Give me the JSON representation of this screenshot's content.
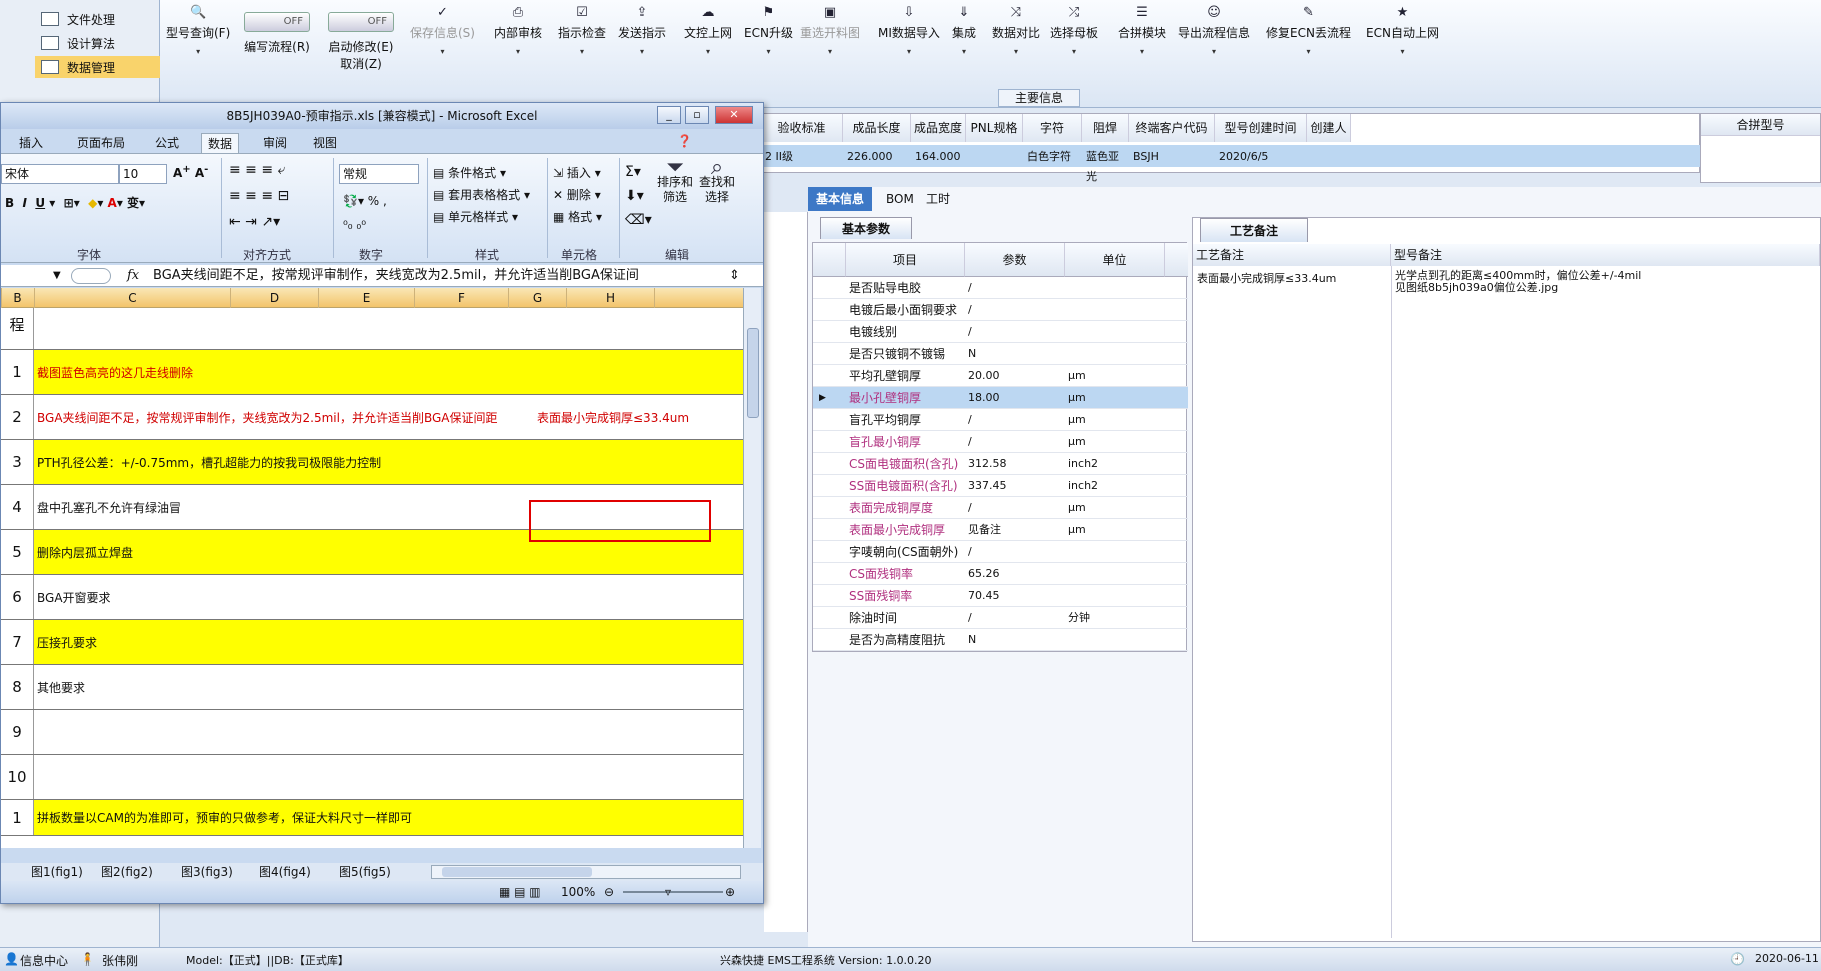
{
  "left_nav": [
    {
      "label": "文件处理"
    },
    {
      "label": "设计算法"
    },
    {
      "label": "数据管理"
    }
  ],
  "ribbon": [
    {
      "icon": "search-icon",
      "glyph": "🔍",
      "label": "型号查询(F)"
    },
    {
      "toggle": "OFF",
      "label": "编写流程(R)"
    },
    {
      "toggle": "OFF",
      "label": "启动修改(E)",
      "sub": "取消(Z)"
    },
    {
      "icon": "check-icon",
      "glyph": "✓",
      "label": "保存信息(S)",
      "disabled": true
    },
    {
      "icon": "print-icon",
      "glyph": "⎙",
      "label": "内部审核"
    },
    {
      "icon": "checkbox-icon",
      "glyph": "☑",
      "label": "指示检查"
    },
    {
      "icon": "upload-icon",
      "glyph": "⇪",
      "label": "发送指示"
    },
    {
      "icon": "cloud-upload-icon",
      "glyph": "☁",
      "label": "文控上网"
    },
    {
      "icon": "ecn-icon",
      "glyph": "⚑",
      "label": "ECN升级"
    },
    {
      "icon": "image-icon",
      "glyph": "▣",
      "label": "重选开料图",
      "disabled": true
    },
    {
      "icon": "download-icon",
      "glyph": "⇩",
      "label": "MI数据导入"
    },
    {
      "icon": "integrate-icon",
      "glyph": "⇓",
      "label": "集成"
    },
    {
      "icon": "compare-icon",
      "glyph": "⤨",
      "label": "数据对比"
    },
    {
      "icon": "shuffle-icon",
      "glyph": "⤮",
      "label": "选择母板"
    },
    {
      "icon": "list-icon",
      "glyph": "☰",
      "label": "合拼模块"
    },
    {
      "icon": "smile-icon",
      "glyph": "☺",
      "label": "导出流程信息"
    },
    {
      "icon": "wrench-icon",
      "glyph": "✎",
      "label": "修复ECN丢流程"
    },
    {
      "icon": "star-icon",
      "glyph": "★",
      "label": "ECN自动上网"
    }
  ],
  "main_info_label": "主要信息",
  "top_grid": {
    "headers": [
      "验收标准",
      "成品长度",
      "成品宽度",
      "PNL规格",
      "字符",
      "阻焊",
      "终端客户代码",
      "型号创建时间",
      "创建人"
    ],
    "row": [
      "2 II级",
      "226.000",
      "164.000",
      "",
      "白色字符",
      "蓝色亚光",
      "BSJH",
      "2020/6/5",
      ""
    ]
  },
  "merge_panel_header": "合拼型号",
  "tabs": [
    "基本信息",
    "BOM",
    "工时"
  ],
  "basic_params_tab": "基本参数",
  "basic_grid": {
    "headers": [
      "项目",
      "参数",
      "单位"
    ],
    "rows": [
      {
        "item": "是否贴导电胶",
        "value": "/",
        "unit": "",
        "pink": false
      },
      {
        "item": "电镀后最小面铜要求",
        "value": "/",
        "unit": "",
        "pink": false
      },
      {
        "item": "电镀线别",
        "value": "/",
        "unit": "",
        "pink": false
      },
      {
        "item": "是否只镀铜不镀锡",
        "value": "N",
        "unit": "",
        "pink": false
      },
      {
        "item": "平均孔壁铜厚",
        "value": "20.00",
        "unit": "μm",
        "pink": false
      },
      {
        "item": "最小孔壁铜厚",
        "value": "18.00",
        "unit": "μm",
        "pink": true,
        "selected": true
      },
      {
        "item": "盲孔平均铜厚",
        "value": "/",
        "unit": "μm",
        "pink": false
      },
      {
        "item": "盲孔最小铜厚",
        "value": "/",
        "unit": "μm",
        "pink": true
      },
      {
        "item": "CS面电镀面积(含孔)",
        "value": "312.58",
        "unit": "inch2",
        "pink": true
      },
      {
        "item": "SS面电镀面积(含孔)",
        "value": "337.45",
        "unit": "inch2",
        "pink": true
      },
      {
        "item": "表面完成铜厚度",
        "value": "/",
        "unit": "μm",
        "pink": true
      },
      {
        "item": "表面最小完成铜厚",
        "value": "见备注",
        "unit": "μm",
        "pink": true
      },
      {
        "item": "字唛朝向(CS面朝外)",
        "value": "/",
        "unit": "",
        "pink": false
      },
      {
        "item": "CS面残铜率",
        "value": "65.26",
        "unit": "",
        "pink": true
      },
      {
        "item": "SS面残铜率",
        "value": "70.45",
        "unit": "",
        "pink": true
      },
      {
        "item": "除油时间",
        "value": "/",
        "unit": "分钟",
        "pink": false
      },
      {
        "item": "是否为高精度阻抗",
        "value": "N",
        "unit": "",
        "pink": false
      }
    ]
  },
  "process_notes": {
    "tab": "工艺备注",
    "col1": "工艺备注",
    "col2": "型号备注",
    "note1": "表面最小完成铜厚≤33.4um",
    "note2_line1": "光学点到孔的距离≤400mm时，偏位公差+/-4mil",
    "note2_line2": "见图纸8b5jh039a0偏位公差.jpg"
  },
  "excel": {
    "title": "8B5JH039A0-预审指示.xls [兼容模式] - Microsoft Excel",
    "tabs": [
      "插入",
      "页面布局",
      "公式",
      "数据",
      "审阅",
      "视图"
    ],
    "active_tab": "数据",
    "font_name": "宋体",
    "font_size": "10",
    "number_format": "常规",
    "groups": [
      "字体",
      "对齐方式",
      "数字",
      "样式",
      "单元格",
      "编辑"
    ],
    "styles": [
      "条件格式",
      "套用表格格式",
      "单元格样式"
    ],
    "cells_cmds": [
      "插入",
      "删除",
      "格式"
    ],
    "edit_cmds": [
      "排序和筛选",
      "查找和选择"
    ],
    "formula_text": "BGA夹线间距不足，按常规评审制作，夹线宽改为2.5mil，并允许适当削BGA保证间",
    "columns": [
      "B",
      "C",
      "D",
      "E",
      "F",
      "G",
      "H"
    ],
    "header_cell": "程",
    "rows": [
      {
        "num": "1",
        "text": "截图蓝色高亮的这几走线删除",
        "yellow": true,
        "red": true
      },
      {
        "num": "2",
        "text": "BGA夹线间距不足，按常规评审制作，夹线宽改为2.5mil，并允许适当削BGA保证间距",
        "yellow": false,
        "red": true,
        "extra": "表面最小完成铜厚≤33.4um"
      },
      {
        "num": "3",
        "text": "PTH孔径公差：+/-0.75mm，槽孔超能力的按我司极限能力控制",
        "yellow": true,
        "red": false
      },
      {
        "num": "4",
        "text": "盘中孔塞孔不允许有绿油冒",
        "yellow": false,
        "red": false
      },
      {
        "num": "5",
        "text": "删除内层孤立焊盘",
        "yellow": true,
        "red": false
      },
      {
        "num": "6",
        "text": "BGA开窗要求",
        "yellow": false,
        "red": false
      },
      {
        "num": "7",
        "text": "压接孔要求",
        "yellow": true,
        "red": false
      },
      {
        "num": "8",
        "text": "其他要求",
        "yellow": false,
        "red": false
      },
      {
        "num": "9",
        "text": "",
        "yellow": false,
        "red": false
      },
      {
        "num": "10",
        "text": "",
        "yellow": false,
        "red": false
      },
      {
        "num": "1",
        "text": "拼板数量以CAM的为准即可，预审的只做参考，保证大料尺寸一样即可",
        "yellow": true,
        "red": false
      }
    ],
    "sheet_tabs": [
      "图1(fig1)",
      "图2(fig2)",
      "图3(fig3)",
      "图4(fig4)",
      "图5(fig5)"
    ],
    "zoom": "100%"
  },
  "status": {
    "info_center": "信息中心",
    "user": "张伟刚",
    "model": "Model:【正式】||DB:【正式库】",
    "system": "兴森快捷 EMS工程系统 Version: 1.0.0.20",
    "date": "2020-06-11"
  }
}
